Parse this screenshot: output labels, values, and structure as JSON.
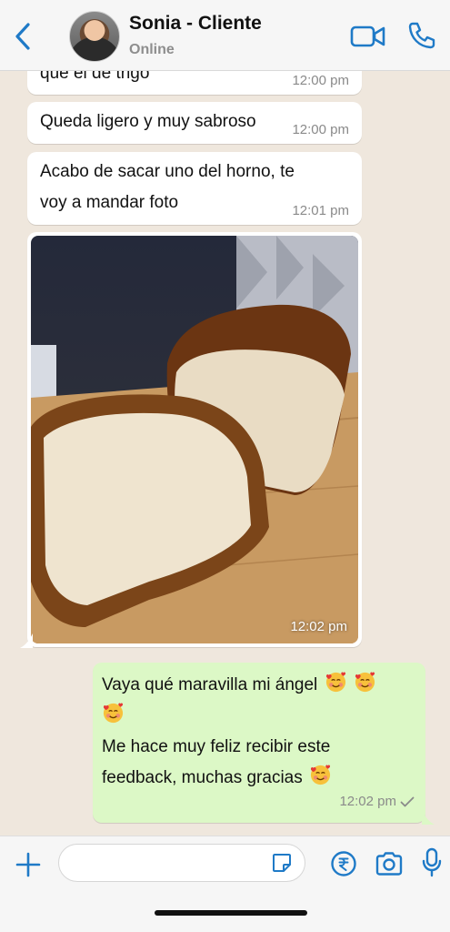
{
  "header": {
    "contact_name": "Sonia - Cliente",
    "status": "Online",
    "accent_color": "#1f7ac7"
  },
  "messages": [
    {
      "direction": "in",
      "text": "que el de trigo",
      "time": "12:00 pm"
    },
    {
      "direction": "in",
      "text": "Queda ligero y muy sabroso",
      "time": "12:00 pm"
    },
    {
      "direction": "in",
      "text": "Acabo de sacar uno del horno, te voy a mandar foto",
      "time": "12:01 pm"
    },
    {
      "direction": "in",
      "type": "image",
      "image_subject": "bread-loaf-photo",
      "time": "12:02 pm"
    },
    {
      "direction": "out",
      "lines": [
        "Vaya qué maravilla mi ángel",
        "",
        "Me hace muy feliz recibir este",
        "feedback, muchas gracias"
      ],
      "time": "12:02 pm",
      "status_icon": "single-check-icon"
    }
  ],
  "input": {
    "placeholder": ""
  },
  "colors": {
    "chat_background": "#efe7dd",
    "incoming_bubble": "#ffffff",
    "outgoing_bubble": "#dcf8c6",
    "timestamp": "#8a8a8a"
  }
}
